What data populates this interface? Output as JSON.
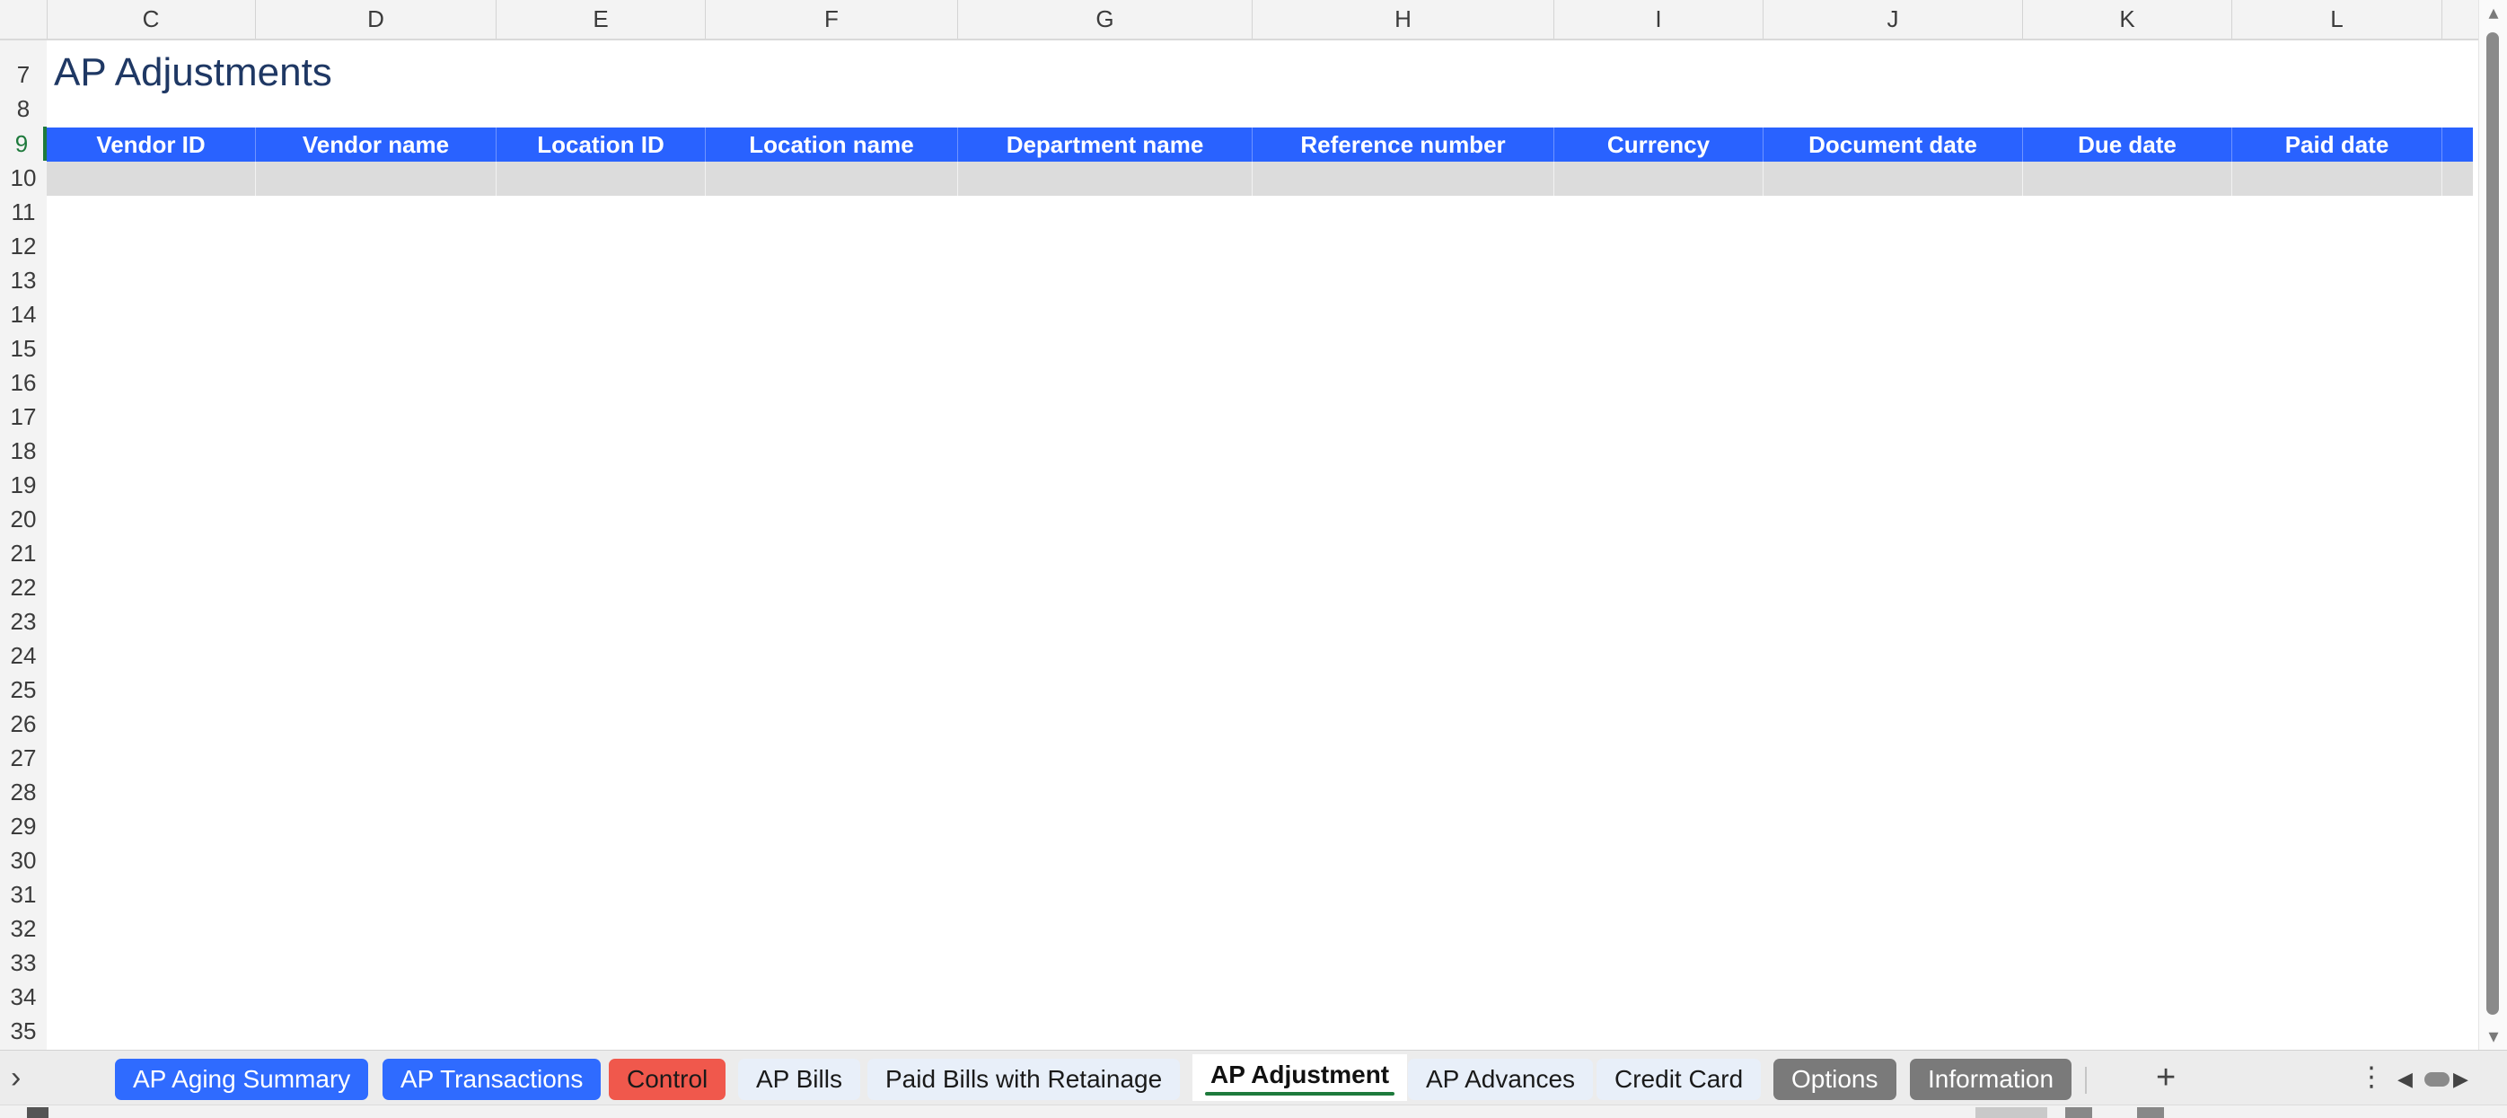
{
  "sheet": {
    "title": "AP Adjustments",
    "columns": [
      "C",
      "D",
      "E",
      "F",
      "G",
      "H",
      "I",
      "J",
      "K",
      "L"
    ],
    "rows": [
      "7",
      "8",
      "9",
      "10",
      "11",
      "12",
      "13",
      "14",
      "15",
      "16",
      "17",
      "18",
      "19",
      "20",
      "21",
      "22",
      "23",
      "24",
      "25",
      "26",
      "27",
      "28",
      "29",
      "30",
      "31",
      "32",
      "33",
      "34",
      "35"
    ],
    "active_row": "9",
    "headers": [
      "Vendor ID",
      "Vendor name",
      "Location ID",
      "Location name",
      "Department name",
      "Reference number",
      "Currency",
      "Document date",
      "Due date",
      "Paid date"
    ]
  },
  "tabs": [
    {
      "label": "AP Aging Summary",
      "style": "blue"
    },
    {
      "label": "AP Transactions",
      "style": "blue"
    },
    {
      "label": "Control",
      "style": "red"
    },
    {
      "label": "AP Bills",
      "style": "light"
    },
    {
      "label": "Paid Bills with Retainage",
      "style": "light"
    },
    {
      "label": "AP Adjustment",
      "style": "active"
    },
    {
      "label": "AP Advances",
      "style": "light"
    },
    {
      "label": "Credit Card",
      "style": "light"
    },
    {
      "label": "Options",
      "style": "gray"
    },
    {
      "label": "Information",
      "style": "gray"
    }
  ],
  "icons": {
    "tab_nav": "chevron-right-icon",
    "add_sheet": "plus-icon",
    "more": "vertical-ellipsis-icon",
    "scroll_left": "triangle-left-icon",
    "scroll_right": "triangle-right-icon"
  },
  "colors": {
    "header_fill": "#2962ff",
    "title_text": "#1f3864",
    "tab_blue": "#2f6bff",
    "tab_red": "#f0584c",
    "tab_gray": "#7a7a7a",
    "active_indicator": "#1e7a3c",
    "data_row_fill": "#dcdcdc"
  }
}
